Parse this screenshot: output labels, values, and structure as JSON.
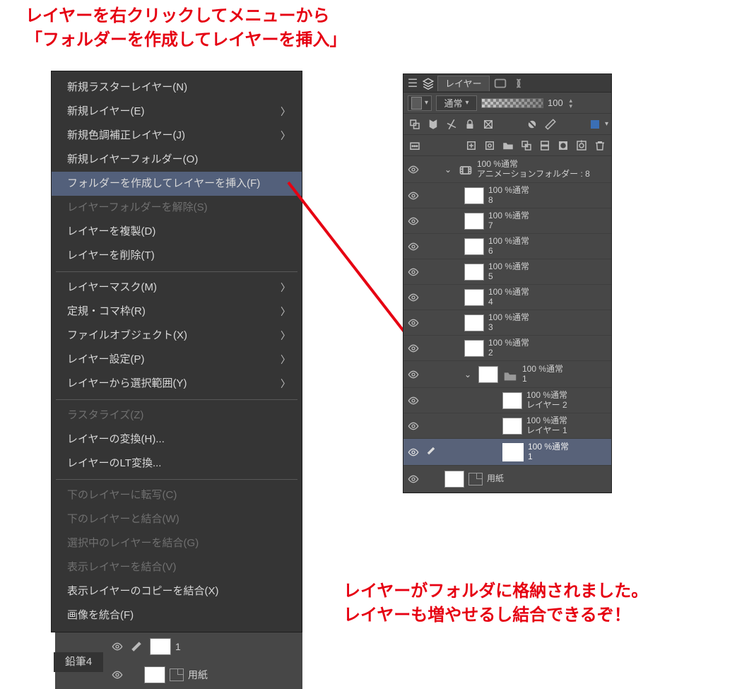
{
  "annotations": {
    "top": "レイヤーを右クリックしてメニューから\n「フォルダーを作成してレイヤーを挿入」",
    "bottom": "レイヤーがフォルダに格納されました。\nレイヤーも増やせるし結合できるぞ！"
  },
  "context_menu": {
    "new_raster": "新規ラスターレイヤー(N)",
    "new_layer": "新規レイヤー(E)",
    "new_correction": "新規色調補正レイヤー(J)",
    "new_folder": "新規レイヤーフォルダー(O)",
    "create_folder_insert": "フォルダーを作成してレイヤーを挿入(F)",
    "release_folder": "レイヤーフォルダーを解除(S)",
    "duplicate": "レイヤーを複製(D)",
    "delete": "レイヤーを削除(T)",
    "layer_mask": "レイヤーマスク(M)",
    "ruler_frame": "定規・コマ枠(R)",
    "file_object": "ファイルオブジェクト(X)",
    "layer_settings": "レイヤー設定(P)",
    "select_from_layer": "レイヤーから選択範囲(Y)",
    "rasterize": "ラスタライズ(Z)",
    "convert": "レイヤーの変換(H)...",
    "lt_convert": "レイヤーのLT変換...",
    "transfer_below": "下のレイヤーに転写(C)",
    "merge_below": "下のレイヤーと結合(W)",
    "merge_selected": "選択中のレイヤーを結合(G)",
    "merge_visible": "表示レイヤーを結合(V)",
    "merge_visible_copy": "表示レイヤーのコピーを結合(X)",
    "flatten": "画像を統合(F)"
  },
  "left_under": {
    "tool": "鉛筆4",
    "layer1_name": "1",
    "paper": "用紙"
  },
  "panel": {
    "tab": "レイヤー",
    "blend_mode": "通常",
    "opacity": "100"
  },
  "layers": {
    "anim_folder": {
      "info": "100 %通常",
      "name": "アニメーションフォルダー : 8"
    },
    "l8": {
      "info": "100 %通常",
      "name": "8"
    },
    "l7": {
      "info": "100 %通常",
      "name": "7"
    },
    "l6": {
      "info": "100 %通常",
      "name": "6"
    },
    "l5": {
      "info": "100 %通常",
      "name": "5"
    },
    "l4": {
      "info": "100 %通常",
      "name": "4"
    },
    "l3": {
      "info": "100 %通常",
      "name": "3"
    },
    "l2": {
      "info": "100 %通常",
      "name": "2"
    },
    "folder1": {
      "info": "100 %通常",
      "name": "1"
    },
    "sub_layer2": {
      "info": "100 %通常",
      "name": "レイヤー 2"
    },
    "sub_layer1": {
      "info": "100 %通常",
      "name": "レイヤー 1"
    },
    "sel1": {
      "info": "100 %通常",
      "name": "1"
    },
    "paper": {
      "name": "用紙"
    }
  }
}
